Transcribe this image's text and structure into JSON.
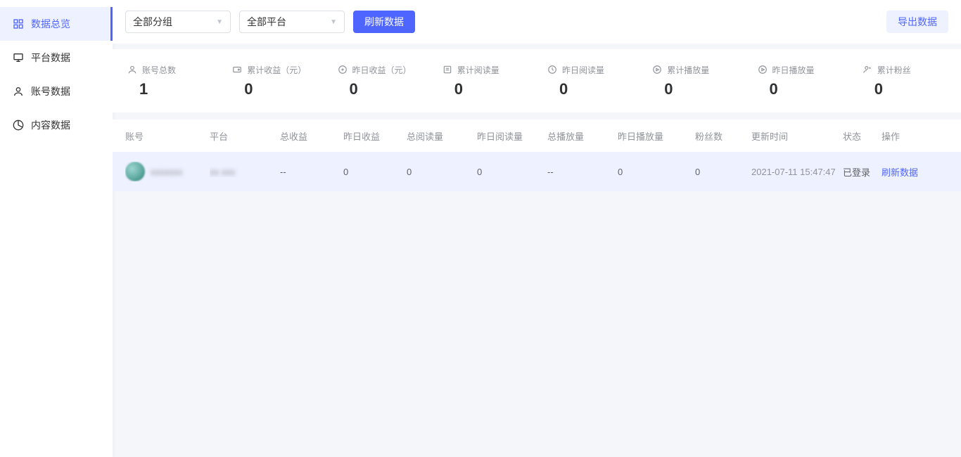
{
  "sidebar": {
    "items": [
      {
        "label": "数据总览",
        "active": true,
        "icon": "overview"
      },
      {
        "label": "平台数据",
        "active": false,
        "icon": "monitor"
      },
      {
        "label": "账号数据",
        "active": false,
        "icon": "user"
      },
      {
        "label": "内容数据",
        "active": false,
        "icon": "pie"
      }
    ]
  },
  "toolbar": {
    "group_select": "全部分组",
    "platform_select": "全部平台",
    "refresh_label": "刷新数据",
    "export_label": "导出数据"
  },
  "stats": [
    {
      "label": "账号总数",
      "value": "1",
      "icon": "user"
    },
    {
      "label": "累计收益（元）",
      "value": "0",
      "icon": "wallet"
    },
    {
      "label": "昨日收益（元）",
      "value": "0",
      "icon": "coin"
    },
    {
      "label": "累计阅读量",
      "value": "0",
      "icon": "read"
    },
    {
      "label": "昨日阅读量",
      "value": "0",
      "icon": "clock"
    },
    {
      "label": "累计播放量",
      "value": "0",
      "icon": "play"
    },
    {
      "label": "昨日播放量",
      "value": "0",
      "icon": "play"
    },
    {
      "label": "累计粉丝",
      "value": "0",
      "icon": "follow"
    }
  ],
  "table": {
    "headers": {
      "account": "账号",
      "platform": "平台",
      "total_income": "总收益",
      "yesterday_income": "昨日收益",
      "total_reads": "总阅读量",
      "yesterday_reads": "昨日阅读量",
      "total_plays": "总播放量",
      "yesterday_plays": "昨日播放量",
      "fans": "粉丝数",
      "updated": "更新时间",
      "status": "状态",
      "action": "操作"
    },
    "rows": [
      {
        "account_masked": "xxxxxxx",
        "platform_masked": "xx  xxx",
        "total_income": "--",
        "yesterday_income": "0",
        "total_reads": "0",
        "yesterday_reads": "0",
        "total_plays": "--",
        "yesterday_plays": "0",
        "fans": "0",
        "updated": "2021-07-11 15:47:47",
        "status": "已登录",
        "action": "刷新数据"
      }
    ]
  }
}
